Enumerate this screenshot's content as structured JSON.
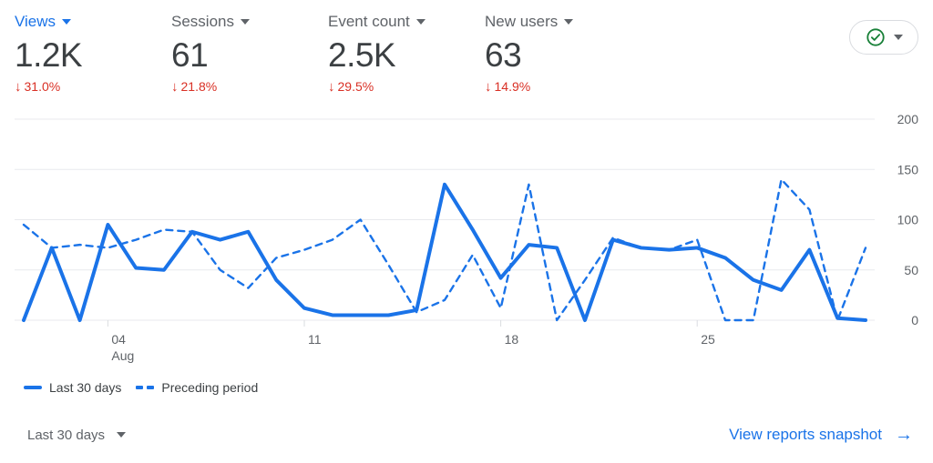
{
  "metrics": [
    {
      "label": "Views",
      "value": "1.2K",
      "delta": "31.0%",
      "delta_icon": "↓",
      "active": true
    },
    {
      "label": "Sessions",
      "value": "61",
      "delta": "21.8%",
      "delta_icon": "↓",
      "active": false
    },
    {
      "label": "Event count",
      "value": "2.5K",
      "delta": "29.5%",
      "delta_icon": "↓",
      "active": false
    },
    {
      "label": "New users",
      "value": "63",
      "delta": "14.9%",
      "delta_icon": "↓",
      "active": false
    }
  ],
  "status_pill": {
    "icon": "check-circle-icon",
    "caret": "chevron-down-icon"
  },
  "legend": [
    {
      "label": "Last 30 days",
      "style": "solid"
    },
    {
      "label": "Preceding period",
      "style": "dashed"
    }
  ],
  "footer": {
    "date_range": "Last 30 days",
    "date_caret": "chevron-down-icon",
    "link_label": "View reports snapshot",
    "link_arrow": "→"
  },
  "colors": {
    "accent": "#1a73e8",
    "negative": "#d93025",
    "text": "#3c4043",
    "muted": "#5f6368",
    "grid": "#e8eaed",
    "check_green": "#188038"
  },
  "chart_data": {
    "type": "line",
    "title": "",
    "xlabel": "",
    "ylabel": "",
    "ylim": [
      0,
      200
    ],
    "yticks": [
      0,
      50,
      100,
      150,
      200
    ],
    "ytick_labels": [
      "0",
      "50",
      "100",
      "150",
      "200"
    ],
    "grid": true,
    "legend_position": "below",
    "x_tick_positions": [
      3,
      10,
      17,
      24
    ],
    "x_tick_labels": [
      "04\nAug",
      "11",
      "18",
      "25"
    ],
    "x_index": [
      0,
      1,
      2,
      3,
      4,
      5,
      6,
      7,
      8,
      9,
      10,
      11,
      12,
      13,
      14,
      15,
      16,
      17,
      18,
      19,
      20,
      21,
      22,
      23,
      24,
      25,
      26,
      27,
      28,
      29
    ],
    "series": [
      {
        "name": "Last 30 days",
        "style": "solid",
        "color": "#1a73e8",
        "values": [
          0,
          72,
          0,
          95,
          52,
          50,
          88,
          80,
          88,
          40,
          12,
          5,
          5,
          5,
          10,
          135,
          90,
          42,
          75,
          72,
          0,
          80,
          72,
          70,
          72,
          62,
          40,
          30,
          70,
          2,
          0
        ]
      },
      {
        "name": "Preceding period",
        "style": "dashed",
        "color": "#1a73e8",
        "values": [
          95,
          72,
          75,
          72,
          80,
          90,
          88,
          50,
          32,
          62,
          70,
          80,
          100,
          55,
          8,
          20,
          65,
          12,
          135,
          0,
          40,
          82,
          72,
          70,
          80,
          0,
          0,
          140,
          110,
          0,
          72
        ]
      }
    ]
  }
}
